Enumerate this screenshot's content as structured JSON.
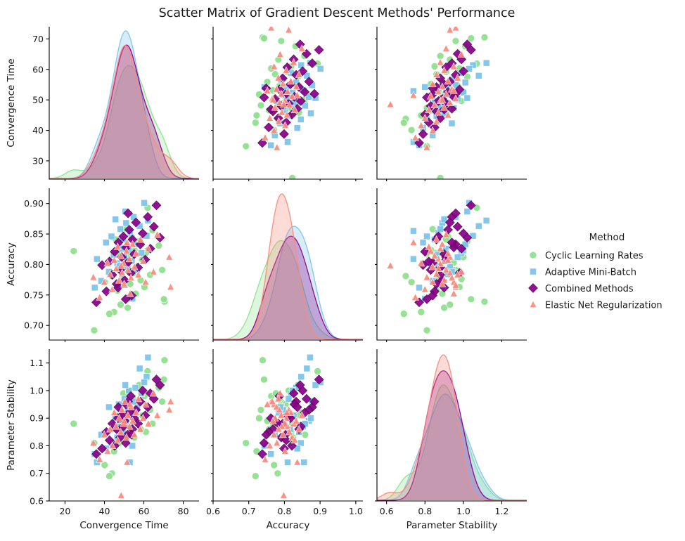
{
  "chart_data": {
    "type": "scatter",
    "title": "Scatter Matrix of Gradient Descent Methods' Performance",
    "variables": [
      "Convergence Time",
      "Accuracy",
      "Parameter Stability"
    ],
    "diagonal": "kde",
    "legend": {
      "title": "Method",
      "position": "right",
      "entries": [
        {
          "name": "Cyclic Learning Rates",
          "color": "#8de08d",
          "marker": "circle"
        },
        {
          "name": "Adaptive Mini-Batch",
          "color": "#7cc3ea",
          "marker": "square"
        },
        {
          "name": "Combined Methods",
          "color": "#8B008B",
          "marker": "diamond"
        },
        {
          "name": "Elastic Net Regularization",
          "color": "#fa8a7c",
          "marker": "triangle"
        }
      ]
    },
    "axes": {
      "Convergence Time": {
        "ticks": [
          20,
          30,
          40,
          50,
          60,
          70,
          80
        ],
        "row_ticks": [
          30,
          40,
          50,
          60,
          70
        ],
        "col_ticks": [
          20,
          40,
          60,
          80
        ],
        "lim": [
          12,
          88
        ]
      },
      "Accuracy": {
        "ticks": [
          0.7,
          0.75,
          0.8,
          0.85,
          0.9
        ],
        "row_ticks": [
          "0.90",
          "0.85",
          "0.80",
          "0.75",
          "0.70"
        ],
        "col_ticks": [
          "0.6",
          "0.7",
          "0.8",
          "0.9",
          "1.0"
        ],
        "lim": [
          0.6,
          1.02
        ]
      },
      "Parameter Stability": {
        "ticks": [
          0.6,
          0.7,
          0.8,
          0.9,
          1.0,
          1.1
        ],
        "row_ticks": [
          "1.1",
          "1.0",
          "0.9",
          "0.8",
          "0.7",
          "0.6"
        ],
        "col_ticks": [
          "0.6",
          "0.8",
          "1.0",
          "1.2"
        ],
        "lim": [
          0.55,
          1.33
        ]
      }
    },
    "row_axis_limits": {
      "Convergence Time": [
        24,
        74
      ],
      "Accuracy": [
        0.676,
        0.925
      ],
      "Parameter Stability": [
        0.6,
        1.15
      ]
    },
    "series": [
      {
        "name": "Cyclic Learning Rates",
        "color": "#8de08d",
        "marker": "circle",
        "convergence_time": [
          70.5,
          70.2,
          69.3,
          67.6,
          64.4,
          63.2,
          61.9,
          61.0,
          60.3,
          59.2,
          58.4,
          57.6,
          56.8,
          55.9,
          55.2,
          54.6,
          53.8,
          53.1,
          52.4,
          51.8,
          51.0,
          50.3,
          49.6,
          48.9,
          48.2,
          47.4,
          46.6,
          45.8,
          44.9,
          43.8,
          42.5,
          40.1,
          34.8,
          24.4
        ],
        "accuracy": [
          0.739,
          0.743,
          0.791,
          0.831,
          0.856,
          0.783,
          0.893,
          0.819,
          0.763,
          0.808,
          0.774,
          0.838,
          0.797,
          0.752,
          0.824,
          0.786,
          0.846,
          0.768,
          0.812,
          0.729,
          0.803,
          0.858,
          0.776,
          0.794,
          0.734,
          0.818,
          0.757,
          0.841,
          0.722,
          0.781,
          0.719,
          0.771,
          0.692,
          0.822
        ],
        "parameter_stability": [
          1.11,
          1.04,
          0.96,
          1.01,
          0.88,
          0.93,
          1.07,
          0.85,
          0.98,
          0.91,
          0.86,
          1.02,
          0.94,
          0.89,
          0.83,
          0.97,
          0.92,
          0.87,
          1.0,
          0.9,
          0.95,
          0.84,
          0.99,
          0.88,
          0.93,
          0.81,
          0.86,
          0.91,
          0.78,
          0.7,
          0.69,
          0.73,
          0.81,
          0.88
        ]
      },
      {
        "name": "Adaptive Mini-Batch",
        "color": "#7cc3ea",
        "marker": "square",
        "convergence_time": [
          62.1,
          61.4,
          60.2,
          58.8,
          57.9,
          56.6,
          55.7,
          54.8,
          53.9,
          53.2,
          52.4,
          51.7,
          51.0,
          50.2,
          49.5,
          48.8,
          48.1,
          47.3,
          46.5,
          45.6,
          44.7,
          43.6,
          42.3,
          40.8,
          38.4,
          36.2,
          35.1,
          50.6,
          49.1,
          47.8,
          52.9,
          54.2
        ],
        "accuracy": [
          0.872,
          0.847,
          0.901,
          0.819,
          0.863,
          0.791,
          0.833,
          0.878,
          0.806,
          0.852,
          0.823,
          0.796,
          0.868,
          0.812,
          0.841,
          0.784,
          0.858,
          0.829,
          0.802,
          0.874,
          0.816,
          0.846,
          0.788,
          0.836,
          0.773,
          0.809,
          0.762,
          0.887,
          0.826,
          0.798,
          0.855,
          0.744
        ],
        "parameter_stability": [
          1.12,
          1.05,
          1.03,
          0.99,
          1.08,
          0.94,
          1.01,
          0.96,
          0.91,
          0.87,
          1.0,
          0.93,
          0.89,
          0.97,
          0.85,
          0.92,
          0.88,
          0.95,
          0.83,
          0.9,
          0.86,
          0.81,
          0.94,
          0.79,
          0.84,
          0.74,
          0.77,
          1.02,
          0.91,
          0.87,
          0.74,
          0.8
        ]
      },
      {
        "name": "Combined Methods",
        "color": "#8B008B",
        "marker": "diamond",
        "convergence_time": [
          68.2,
          66.4,
          65.1,
          63.3,
          62.0,
          60.7,
          59.4,
          58.2,
          57.1,
          56.0,
          55.1,
          54.2,
          53.4,
          52.6,
          51.8,
          51.0,
          50.3,
          49.6,
          48.8,
          48.0,
          47.1,
          46.2,
          45.2,
          44.0,
          42.6,
          41.0,
          38.8,
          35.9,
          52.0,
          50.8,
          53.8,
          46.9
        ],
        "accuracy": [
          0.844,
          0.897,
          0.862,
          0.826,
          0.878,
          0.808,
          0.851,
          0.833,
          0.795,
          0.869,
          0.817,
          0.841,
          0.786,
          0.857,
          0.803,
          0.828,
          0.774,
          0.846,
          0.812,
          0.791,
          0.836,
          0.768,
          0.821,
          0.783,
          0.805,
          0.756,
          0.799,
          0.738,
          0.884,
          0.743,
          0.749,
          0.762
        ],
        "parameter_stability": [
          1.02,
          1.04,
          0.97,
          0.99,
          0.94,
          0.91,
          1.0,
          0.96,
          0.88,
          0.93,
          0.9,
          0.86,
          0.98,
          0.92,
          0.84,
          0.95,
          0.89,
          0.87,
          0.91,
          0.83,
          0.94,
          0.86,
          0.8,
          0.88,
          0.82,
          0.85,
          0.79,
          0.77,
          0.96,
          0.81,
          0.84,
          0.9
        ]
      },
      {
        "name": "Elastic Net Regularization",
        "color": "#fa8a7c",
        "marker": "triangle",
        "convergence_time": [
          73.6,
          72.9,
          66.8,
          64.9,
          62.3,
          60.9,
          59.6,
          58.3,
          57.2,
          56.1,
          55.2,
          54.3,
          53.5,
          52.7,
          51.9,
          51.2,
          50.4,
          49.7,
          49.0,
          48.3,
          47.5,
          46.7,
          45.9,
          45.0,
          44.0,
          42.9,
          41.6,
          39.9,
          37.6,
          34.4,
          51.5,
          50.0,
          53.0,
          48.5
        ],
        "accuracy": [
          0.763,
          0.812,
          0.849,
          0.788,
          0.826,
          0.771,
          0.805,
          0.841,
          0.783,
          0.818,
          0.796,
          0.833,
          0.778,
          0.809,
          0.791,
          0.822,
          0.766,
          0.801,
          0.786,
          0.814,
          0.774,
          0.829,
          0.793,
          0.807,
          0.759,
          0.784,
          0.802,
          0.771,
          0.746,
          0.779,
          0.836,
          0.768,
          0.752,
          0.798
        ],
        "parameter_stability": [
          0.96,
          0.93,
          0.91,
          0.99,
          0.88,
          0.95,
          0.9,
          0.86,
          0.97,
          0.92,
          0.84,
          0.89,
          0.94,
          0.87,
          0.91,
          0.83,
          0.96,
          0.88,
          0.93,
          0.85,
          0.9,
          0.82,
          0.87,
          0.92,
          0.8,
          0.86,
          0.78,
          0.84,
          0.75,
          0.81,
          0.74,
          0.89,
          0.95,
          0.62
        ]
      }
    ]
  }
}
